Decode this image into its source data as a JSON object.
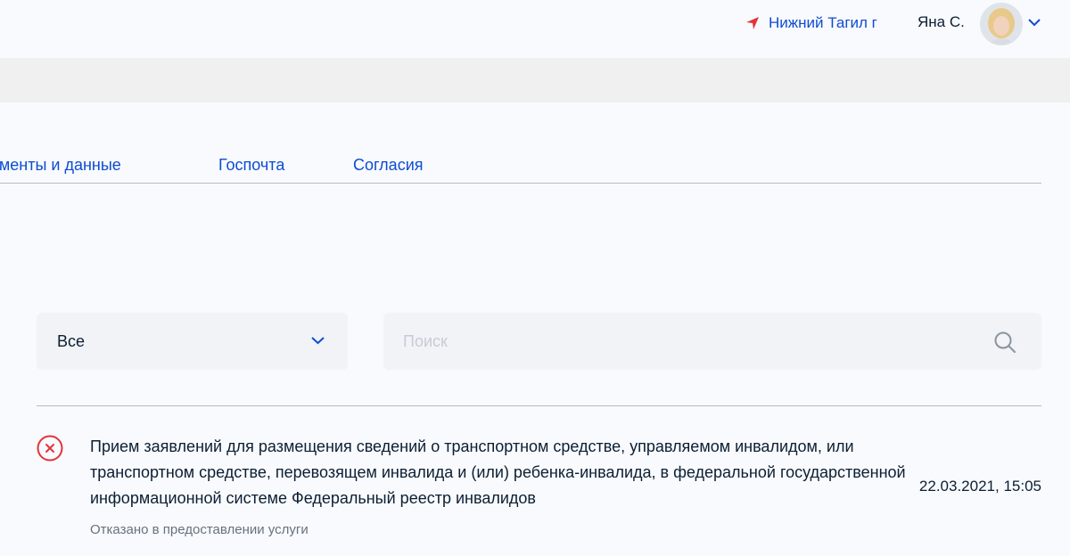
{
  "header": {
    "location": "Нижний Тагил г",
    "user_name": "Яна С."
  },
  "tabs": [
    {
      "label": "окументы и данные"
    },
    {
      "label": "Госпочта"
    },
    {
      "label": "Согласия"
    }
  ],
  "filter": {
    "select_value": "Все",
    "search_placeholder": "Поиск"
  },
  "items": [
    {
      "title": "Прием заявлений для размещения сведений о транспортном средстве, управляемом инвалидом, или транспортном средстве, перевозящем инвалида и (или) ребенка-инвалида, в федеральной государственной информационной системе Федеральный реестр инвалидов",
      "status": "Отказано в предоставлении услуги",
      "date": "22.03.2021, 15:05"
    }
  ],
  "colors": {
    "link": "#0d4cd3",
    "error": "#e1353b",
    "text": "#0b1f33",
    "muted": "#66727f"
  },
  "icons": {
    "location": "location-arrow-icon",
    "user_menu": "chevron-down-icon",
    "select": "chevron-down-icon",
    "search": "search-icon",
    "status": "error-circle-icon"
  }
}
